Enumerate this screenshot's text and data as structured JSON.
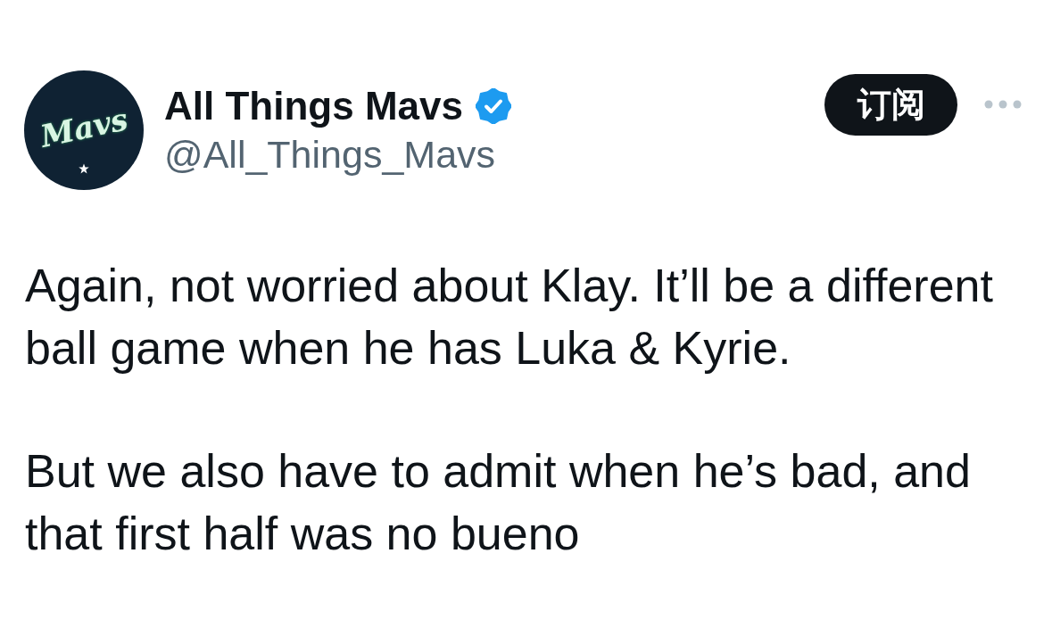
{
  "author": {
    "avatar": {
      "logo_text": "Mavs"
    },
    "name": "All Things Mavs",
    "verified": true,
    "handle": "@All_Things_Mavs"
  },
  "subscribe_button": {
    "label": "订阅"
  },
  "tweet": {
    "paragraphs": [
      "Again, not worried about Klay. It’ll be a different ball game when he has Luka & Kyrie.",
      "But we also have to admit when he’s bad, and that first half was no bueno"
    ]
  }
}
